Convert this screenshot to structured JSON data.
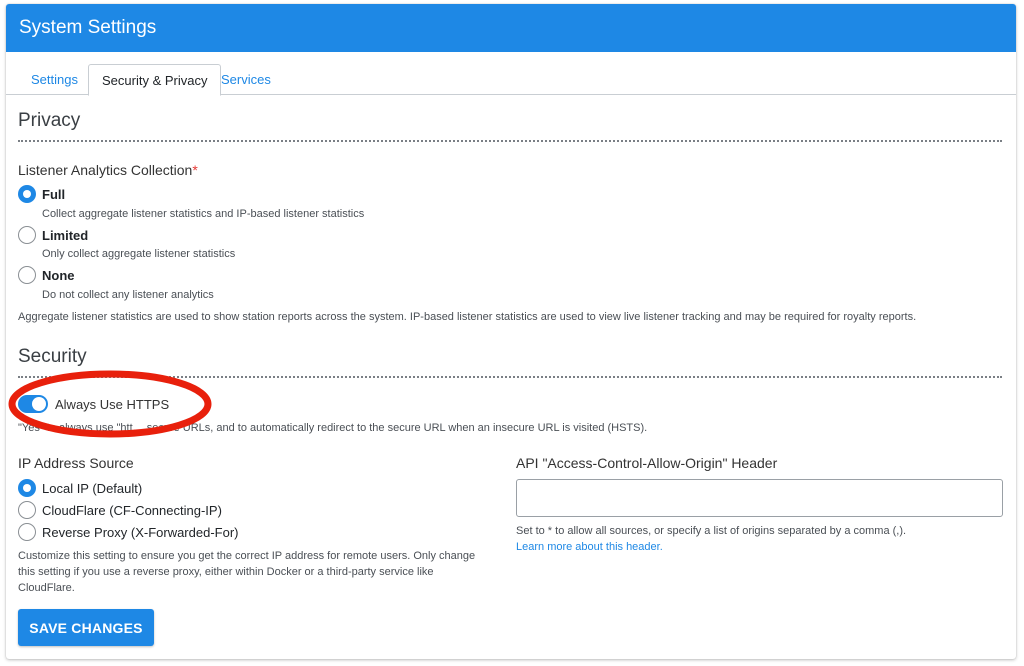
{
  "header": {
    "title": "System Settings"
  },
  "tabs": [
    {
      "label": "Settings",
      "active": false
    },
    {
      "label": "Security & Privacy",
      "active": true
    },
    {
      "label": "Services",
      "active": false
    }
  ],
  "privacy": {
    "title": "Privacy",
    "analytics_label": "Listener Analytics Collection",
    "required_mark": "*",
    "options": [
      {
        "label": "Full",
        "description": "Collect aggregate listener statistics and IP-based listener statistics",
        "selected": true
      },
      {
        "label": "Limited",
        "description": "Only collect aggregate listener statistics",
        "selected": false
      },
      {
        "label": "None",
        "description": "Do not collect any listener analytics",
        "selected": false
      }
    ],
    "help": "Aggregate listener statistics are used to show station reports across the system. IP-based listener statistics are used to view live listener tracking and may be required for royalty reports."
  },
  "security": {
    "title": "Security",
    "https_toggle": {
      "label": "Always Use HTTPS",
      "on": true
    },
    "https_help_visible": "\"Yes\" to always use \"htt… secure URLs, and to automatically redirect to the secure URL when an insecure URL is visited (HSTS).",
    "ip_source": {
      "label": "IP Address Source",
      "options": [
        {
          "label": "Local IP (Default)",
          "selected": true
        },
        {
          "label": "CloudFlare (CF-Connecting-IP)",
          "selected": false
        },
        {
          "label": "Reverse Proxy (X-Forwarded-For)",
          "selected": false
        }
      ],
      "help": "Customize this setting to ensure you get the correct IP address for remote users. Only change this setting if you use a reverse proxy, either within Docker or a third-party service like CloudFlare."
    },
    "cors": {
      "label": "API \"Access-Control-Allow-Origin\" Header",
      "value": "",
      "placeholder": "",
      "help": "Set to * to allow all sources, or specify a list of origins separated by a comma (,).",
      "link": "Learn more about this header."
    }
  },
  "actions": {
    "save_label": "SAVE CHANGES"
  },
  "colors": {
    "primary": "#1e88e5",
    "annotation": "#e8200c",
    "required": "#e53935"
  }
}
